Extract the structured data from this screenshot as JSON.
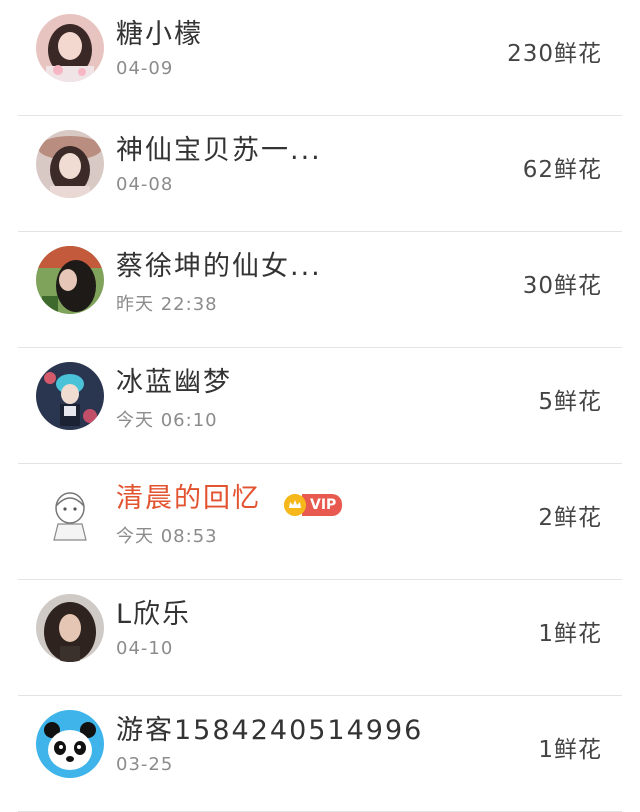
{
  "entries": [
    {
      "name": "糖小檬",
      "time": "04-09",
      "flowers": "230鲜花",
      "avatar": "avatar-girl-pink"
    },
    {
      "name": "神仙宝贝苏一...",
      "time": "04-08",
      "flowers": "62鲜花",
      "avatar": "avatar-girl-hat"
    },
    {
      "name": "蔡徐坤的仙女...",
      "time": "昨天 22:38",
      "flowers": "30鲜花",
      "avatar": "avatar-girl-dark"
    },
    {
      "name": "冰蓝幽梦",
      "time": "今天 06:10",
      "flowers": "5鲜花",
      "avatar": "avatar-anime-blue"
    },
    {
      "name": "清晨的回忆",
      "time": "今天 08:53",
      "flowers": "2鲜花",
      "avatar": "avatar-sketch-girl",
      "vip": "VIP"
    },
    {
      "name": "L欣乐",
      "time": "04-10",
      "flowers": "1鲜花",
      "avatar": "avatar-woman-curly"
    },
    {
      "name": "游客1584240514996",
      "time": "03-25",
      "flowers": "1鲜花",
      "avatar": "avatar-panda"
    }
  ],
  "colors": {
    "vip_name": "#e2532f",
    "vip_tag": "#e85a4f",
    "crown": "#f5b719",
    "divider": "#e3e3e3"
  }
}
